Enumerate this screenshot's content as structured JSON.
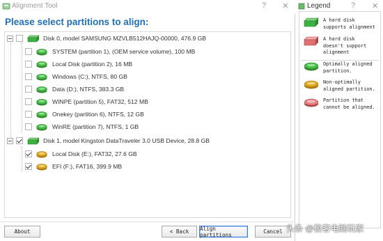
{
  "window": {
    "title": "Alignment Tool",
    "help_glyph": "?",
    "close_glyph": "✕"
  },
  "heading": "Please select partitions to align:",
  "disks": [
    {
      "label": "Disk 0, model SAMSUNG MZVLB512HAJQ-00000, 476.9 GB",
      "checked": false,
      "partitions": [
        {
          "label": "SYSTEM (partition 1),  (OEM service volume), 100 MB",
          "checked": false,
          "status": "optimal"
        },
        {
          "label": "Local Disk (partition 2), 16 MB",
          "checked": false,
          "status": "optimal"
        },
        {
          "label": "Windows (C:), NTFS, 80 GB",
          "checked": false,
          "status": "optimal"
        },
        {
          "label": "Data (D:), NTFS, 383.3 GB",
          "checked": false,
          "status": "optimal"
        },
        {
          "label": "WINPE (partition 5), FAT32, 512 MB",
          "checked": false,
          "status": "optimal"
        },
        {
          "label": "Onekey (partition 6), NTFS, 12 GB",
          "checked": false,
          "status": "optimal"
        },
        {
          "label": "WinRE (partition 7), NTFS, 1 GB",
          "checked": false,
          "status": "optimal"
        }
      ]
    },
    {
      "label": "Disk 1, model Kingston DataTraveler 3.0 USB Device, 28.8 GB",
      "checked": true,
      "partitions": [
        {
          "label": "Local Disk (E:), FAT32, 27.6 GB",
          "checked": true,
          "status": "non-optimal"
        },
        {
          "label": "EFI (F:), FAT16, 399.9 MB",
          "checked": true,
          "status": "non-optimal"
        }
      ]
    }
  ],
  "buttons": {
    "about": "About",
    "back": "< Back",
    "align": "Align partitions",
    "cancel": "Cancel"
  },
  "legend": {
    "title": "Legend",
    "help_glyph": "?",
    "close_glyph": "✕",
    "items": [
      {
        "text": "A hard disk supports alignment",
        "icon": "disk-supported-icon"
      },
      {
        "text": "A hard disk doesn't support alignment",
        "icon": "disk-unsupported-icon"
      },
      {
        "text": "Optimally aligned partition.",
        "icon": "partition-optimal-icon"
      },
      {
        "text": "Non-optimally aligned partition.",
        "icon": "partition-nonoptimal-icon"
      },
      {
        "text": "Partition that cannot be aligned.",
        "icon": "partition-unalignable-icon"
      }
    ]
  },
  "watermark": "头条 @极客电脑玩家",
  "colors": {
    "heading": "#1f6fb9",
    "green": "#3cb043",
    "gold": "#d9a521",
    "red": "#e07070"
  }
}
